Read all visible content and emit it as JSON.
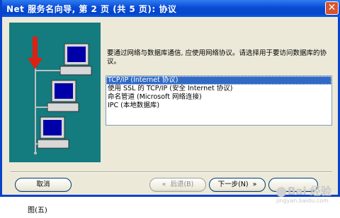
{
  "window": {
    "title": "Net 服务名向导, 第 2 页 (共 5 页): 协议",
    "close_label": "✕"
  },
  "prompt": "要通过网络与数据库通信, 应使用网络协议。请选择用于要访问数据库的协议。",
  "protocols": [
    {
      "label": "TCP/IP (Internet 协议)",
      "selected": true
    },
    {
      "label": "使用 SSL 的 TCP/IP (安全 Internet 协议)",
      "selected": false
    },
    {
      "label": "命名管道 (Microsoft 网络连接)",
      "selected": false
    },
    {
      "label": "IPC (本地数据库)",
      "selected": false
    }
  ],
  "buttons": {
    "cancel": "取消",
    "back": "后退(B)",
    "next": "下一步(N)",
    "finish": ""
  },
  "caption": "图(五)",
  "watermark": {
    "text": "Bai 经验",
    "sub": "jingyan.baidu.com"
  },
  "colors": {
    "title_bar": "#0a4ad6",
    "illustration_bg": "#147b7f",
    "selection": "#316ac5"
  }
}
